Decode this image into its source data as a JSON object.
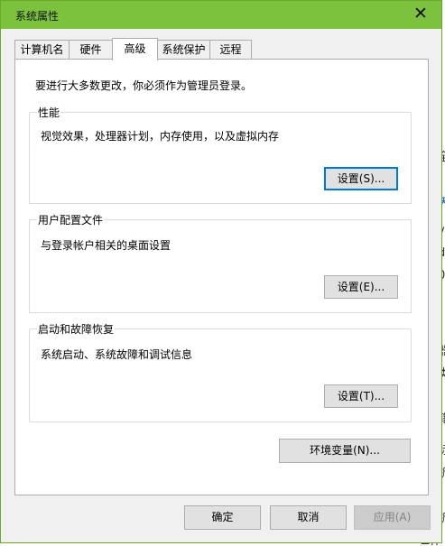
{
  "window": {
    "title": "系统属性",
    "close_symbol": "✕"
  },
  "tabs": [
    {
      "label": "计算机名",
      "active": false
    },
    {
      "label": "硬件",
      "active": false
    },
    {
      "label": "高级",
      "active": true
    },
    {
      "label": "系统保护",
      "active": false
    },
    {
      "label": "远程",
      "active": false
    }
  ],
  "advanced": {
    "intro": "要进行大多数更改，你必须作为管理员登录。",
    "performance": {
      "title": "性能",
      "description": "视觉效果，处理器计划，内存使用，以及虚拟内存",
      "button": "设置(S)..."
    },
    "user_profiles": {
      "title": "用户配置文件",
      "description": "与登录帐户相关的桌面设置",
      "button": "设置(E)..."
    },
    "startup_recovery": {
      "title": "启动和故障恢复",
      "description": "系统启动、系统故障和调试信息",
      "button": "设置(T)..."
    },
    "env_button": "环境变量(N)..."
  },
  "footer": {
    "ok": "确定",
    "cancel": "取消",
    "apply": "应用(A)"
  },
  "background_fragments": [
    "全",
    "关",
    "vs",
    "do",
    "07",
    "器",
    "类",
    "籍",
    "标",
    "析",
    "析",
    "工作"
  ],
  "colors": {
    "titlebar": "#7cc23d",
    "focus": "#0078d7"
  }
}
